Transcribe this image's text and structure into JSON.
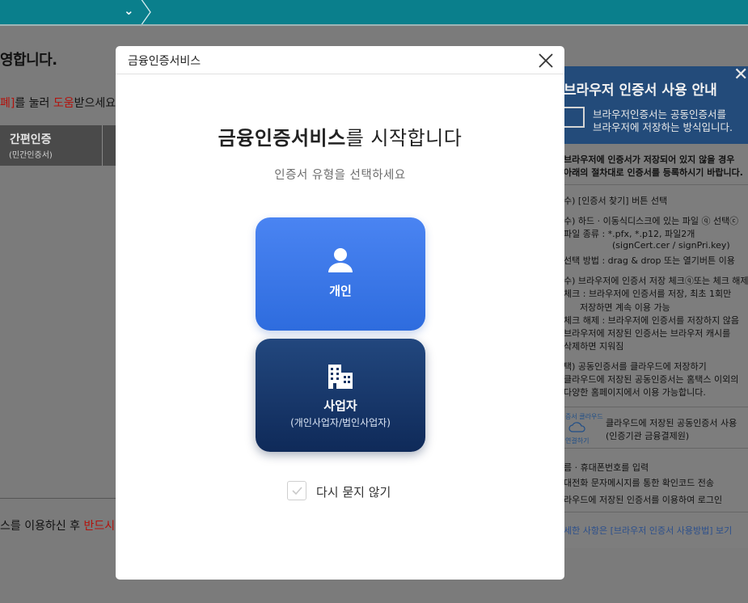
{
  "background": {
    "title_fragment": "영합니다.",
    "help_fragment_1": "폐]",
    "help_fragment_2": "를 눌러 ",
    "help_fragment_red": "도움",
    "help_fragment_3": "받으세요",
    "tab_easy_cert": "간편인증",
    "tab_easy_cert_sub": "(민간인증서)",
    "notice_fragment": "스를 이용하신 후 ",
    "notice_fragment_red": "반드시"
  },
  "guide": {
    "title": "브라우저 인증서 사용 안내",
    "desc_1": "브라우저인증서는 공동인증서를",
    "desc_2": "브라우저에 저장하는 방식입니다.",
    "intro_1": "브라우저에 인증서가 저장되어 있지 않을 경우",
    "intro_2": "아래의 절차대로 인증서를 등록하시기 바랍니다.",
    "steps": [
      "수) [인증서 찾기] 버튼 선택",
      "수) 하드 · 이동식디스크에 있는 파일 ⓠ 선택ⓒ",
      "파일 종류 : *.pfx, *.p12, 파일2개",
      "(signCert.cer / signPri.key)",
      "선택 방법 : drag & drop 또는 열기버튼 이용",
      "수) 브라우저에 인증서 저장 체크ⓠ또는 체크 해제ⓒ",
      "체크 : 브라우저에 인증서를 저장, 최초 1회만",
      "저장하면 계속 이용 가능",
      "체크 해제 : 브라우저에 인증서를 저장하지 않음",
      "브라우저에 저장된 인증서는 브라우저 캐시를",
      "삭제하면 지워짐",
      "택) 공동인증서를 클라우드에 저장하기",
      "클라우드에 저장된 공동인증서는 홈택스 이외의",
      "다양한 홈페이지에서 이용 가능합니다."
    ],
    "cloud_label_top": "증서 클라우드",
    "cloud_label_bottom": "연결하기",
    "cloud_text_1": "클라우드에 저장된 공동인증서 사용",
    "cloud_text_2": "(인증기관 금융결제원)",
    "bottom_steps": [
      "름 · 휴대폰번호를 입력",
      "대전화 문자메시지를 통한 확인코드 전송",
      "라우드에 저장된 인증서를 이용하여 로그인"
    ],
    "footer": "세한 사항은 [브라우저 인증서 사용방법] 보기"
  },
  "modal": {
    "title": "금융인증서비스",
    "headline_bold": "금융인증서비스",
    "headline_rest": "를 시작합니다",
    "subheading": "인증서 유형을 선택하세요",
    "option_personal": "개인",
    "option_business": "사업자",
    "option_business_sub": "(개인사업자/법인사업자)",
    "dont_ask_again": "다시 묻지 않기",
    "dont_ask_checked": false
  },
  "colors": {
    "topbar": "#0a7f8c",
    "personal_card": "#3a78ea",
    "business_card": "#163565",
    "accent_red": "#b3120c"
  }
}
